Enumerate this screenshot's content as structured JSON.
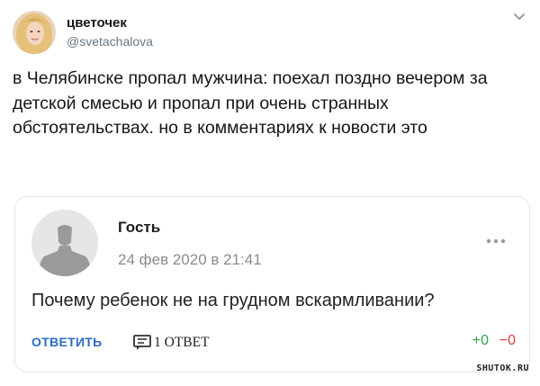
{
  "tweet": {
    "display_name": "цветочек",
    "handle": "@svetachalova",
    "avatar_icon": "user-photo",
    "menu_icon": "chevron-down-icon",
    "text": "в Челябинске пропал мужчина: поехал поздно вечером за детской смесью и пропал при очень странных обстоятельствах. но в комментариях к новости это"
  },
  "comment": {
    "author": "Гость",
    "avatar_icon": "default-user-icon",
    "date": "24 фев 2020 в 21:41",
    "more_icon": "more-dots-icon",
    "body": "Почему ребенок не на грудном вскармливании?",
    "reply_label": "ОТВЕТИТЬ",
    "replies_icon": "comment-icon",
    "replies_label": "1 ОТВЕТ",
    "votes_up": "+0",
    "votes_down": "−0",
    "colors": {
      "link": "#2a6cc3",
      "up": "#2ea84a",
      "down": "#e0403b"
    }
  },
  "watermark": "SHUTOK.RU"
}
